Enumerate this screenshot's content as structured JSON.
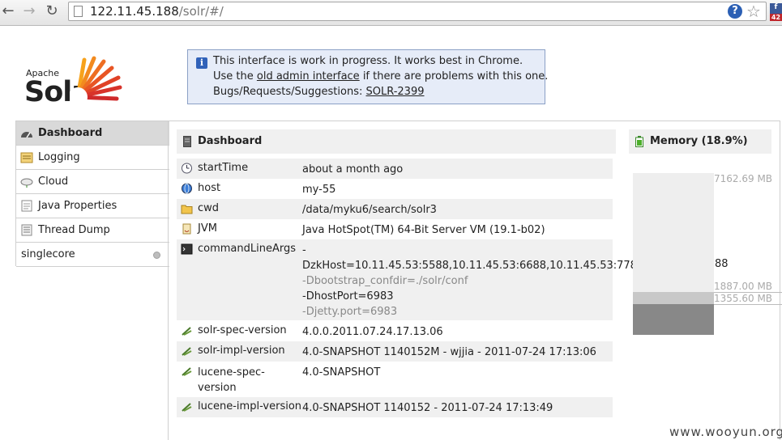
{
  "browser": {
    "url_host": "122.11.45.188",
    "url_path": "/solr/#/",
    "ext_badge": "f",
    "ext_count": "42"
  },
  "logo": {
    "apache": "Apache",
    "solr": "Solr"
  },
  "notice": {
    "line1": "This interface is work in progress. It works best in Chrome.",
    "line2_pre": "Use the ",
    "line2_link": "old admin interface",
    "line2_post": " if there are problems with this one.",
    "line3_pre": "Bugs/Requests/Suggestions: ",
    "line3_link": "SOLR-2399"
  },
  "sidebar": {
    "items": [
      {
        "label": "Dashboard",
        "icon": "dashboard-icon"
      },
      {
        "label": "Logging",
        "icon": "logging-icon"
      },
      {
        "label": "Cloud",
        "icon": "cloud-icon"
      },
      {
        "label": "Java Properties",
        "icon": "java-properties-icon"
      },
      {
        "label": "Thread Dump",
        "icon": "thread-dump-icon"
      }
    ],
    "core": "singlecore"
  },
  "dashboard": {
    "title": "Dashboard",
    "rows": [
      {
        "key": "startTime",
        "value": "about a month ago"
      },
      {
        "key": "host",
        "value": "my-55"
      },
      {
        "key": "cwd",
        "value": "/data/myku6/search/solr3"
      },
      {
        "key": "JVM",
        "value": "Java HotSpot(TM) 64-Bit Server VM (19.1-b02)"
      },
      {
        "key": "commandLineArgs",
        "args": [
          "-",
          "DzkHost=10.11.45.53:5588,10.11.45.53:6688,10.11.45.53:7788",
          "-Dbootstrap_confdir=./solr/conf",
          "-DhostPort=6983",
          "-Djetty.port=6983"
        ],
        "overflow": "88"
      },
      {
        "key": "solr-spec-version",
        "value": "4.0.0.2011.07.24.17.13.06"
      },
      {
        "key": "solr-impl-version",
        "value": "4.0-SNAPSHOT 1140152M - wjjia - 2011-07-24 17:13:06"
      },
      {
        "key": "lucene-spec-",
        "key2": "version",
        "value": "4.0-SNAPSHOT"
      },
      {
        "key": "lucene-impl-version",
        "value": "4.0-SNAPSHOT 1140152 - 2011-07-24 17:13:49"
      }
    ]
  },
  "memory": {
    "title": "Memory (18.9%)",
    "max_label": "7162.69 MB",
    "total_label": "1887.00 MB",
    "used_label": "1355.60 MB",
    "max_mb": 7162.69,
    "total_mb": 1887.0,
    "used_mb": 1355.6,
    "colors": {
      "max": "#eeeeee",
      "total": "#c8c8c8",
      "used": "#888888"
    }
  },
  "watermark": "www.wooyun.org"
}
